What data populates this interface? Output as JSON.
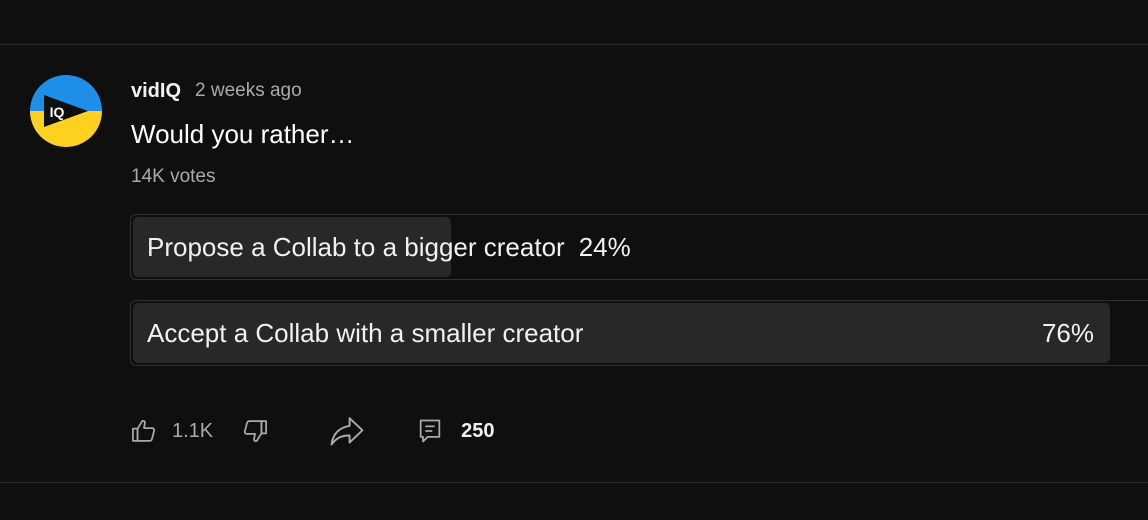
{
  "post": {
    "author": "vidIQ",
    "time": "2 weeks ago",
    "text": "Would you rather…",
    "votes": "14K votes",
    "avatar_text": "IQ"
  },
  "poll": {
    "options": [
      {
        "label": "Propose a Collab to a bigger creator",
        "percent_text": "24%",
        "percent": 24
      },
      {
        "label": "Accept a Collab with a smaller creator",
        "percent_text": "76%",
        "percent": 76
      }
    ]
  },
  "actions": {
    "like_count": "1.1K",
    "comment_count": "250",
    "icons": [
      "thumbs-up-icon",
      "thumbs-down-icon",
      "share-icon",
      "comment-icon"
    ]
  },
  "colors": {
    "background": "#0f0f0f",
    "fill": "#282828",
    "muted_text": "#aaaaaa",
    "avatar_blue": "#1e8fe8",
    "avatar_yellow": "#ffd21f"
  }
}
